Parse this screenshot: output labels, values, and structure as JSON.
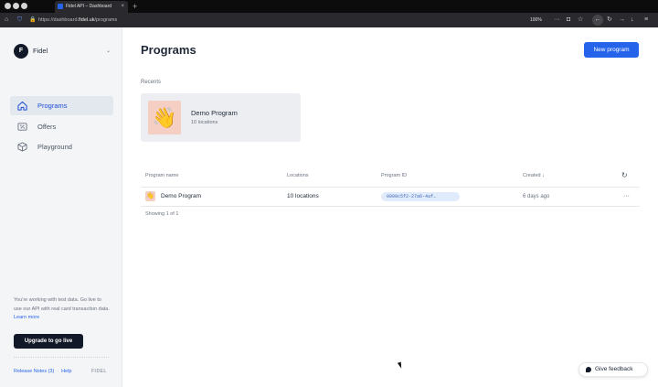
{
  "browser": {
    "tab_title": "Fidel API – Dashboard",
    "tab_close": "×",
    "new_tab": "+",
    "url_prefix": "https://dashboard.",
    "url_host": "fidel.uk",
    "url_path": "/programs",
    "zoom": "100%"
  },
  "sidebar": {
    "org_initial": "F",
    "org_name": "Fidel",
    "items": [
      {
        "label": "Programs",
        "active": true
      },
      {
        "label": "Offers",
        "active": false
      },
      {
        "label": "Playground",
        "active": false
      }
    ],
    "test_note": "You're working with test data. Go live to use our API with real card transaction data.",
    "learn_more": "Learn more",
    "upgrade_label": "Upgrade to go live",
    "release_notes": "Release Notes (3)",
    "separator": "·",
    "help": "Help",
    "logo": "FIDEL"
  },
  "main": {
    "title": "Programs",
    "new_program_label": "New program",
    "recents_label": "Recents",
    "recent": {
      "emoji": "👋",
      "name": "Demo Program",
      "sub": "10 locations"
    },
    "table": {
      "headers": [
        "Program name",
        "Locations",
        "Program ID",
        "Created ↓"
      ],
      "rows": [
        {
          "emoji": "👋",
          "name": "Demo Program",
          "locations": "10 locations",
          "id": "0000c5f2-27a6-4af…",
          "created": "6 days ago"
        }
      ],
      "showing": "Showing 1 of 1"
    }
  },
  "feedback_label": "Give feedback"
}
